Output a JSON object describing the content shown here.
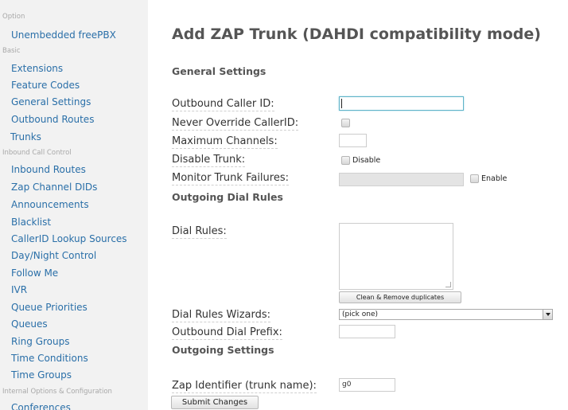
{
  "sidebar": {
    "sections": {
      "option": "Option",
      "basic": "Basic",
      "inbound": "Inbound Call Control",
      "internal": "Internal Options & Configuration"
    },
    "items": {
      "unembedded": "Unembedded freePBX",
      "extensions": "Extensions",
      "feature_codes": "Feature Codes",
      "general_settings": "General Settings",
      "outbound_routes": "Outbound Routes",
      "trunks": "Trunks",
      "inbound_routes": "Inbound Routes",
      "zap_channel_dids": "Zap Channel DIDs",
      "announcements": "Announcements",
      "blacklist": "Blacklist",
      "callerid_lookup": "CallerID Lookup Sources",
      "day_night": "Day/Night Control",
      "follow_me": "Follow Me",
      "ivr": "IVR",
      "queue_priorities": "Queue Priorities",
      "queues": "Queues",
      "ring_groups": "Ring Groups",
      "time_conditions": "Time Conditions",
      "time_groups": "Time Groups",
      "conferences": "Conferences"
    }
  },
  "main": {
    "title": "Add ZAP Trunk (DAHDI compatibility mode)",
    "sections": {
      "general": "General Settings",
      "dial_rules": "Outgoing Dial Rules",
      "outgoing": "Outgoing Settings"
    },
    "fields": {
      "outbound_cid_label": "Outbound Caller ID:",
      "outbound_cid_value": "",
      "never_override_label": "Never Override CallerID:",
      "max_channels_label": "Maximum Channels:",
      "max_channels_value": "",
      "disable_trunk_label": "Disable Trunk:",
      "disable_checkbox_label": "Disable",
      "monitor_label": "Monitor Trunk Failures:",
      "monitor_value": "",
      "enable_checkbox_label": "Enable",
      "dial_rules_label": "Dial Rules:",
      "clean_button": "Clean & Remove duplicates",
      "wizards_label": "Dial Rules Wizards:",
      "wizards_selected": "(pick one)",
      "prefix_label": "Outbound Dial Prefix:",
      "prefix_value": "",
      "zap_id_label": "Zap Identifier (trunk name):",
      "zap_id_value": "g0",
      "submit_button": "Submit Changes"
    }
  },
  "colors": {
    "sidebar_bg": "#f2f2f2",
    "link": "#2a6fa8",
    "heading": "#555555",
    "focus_border": "#5fb3c8"
  }
}
